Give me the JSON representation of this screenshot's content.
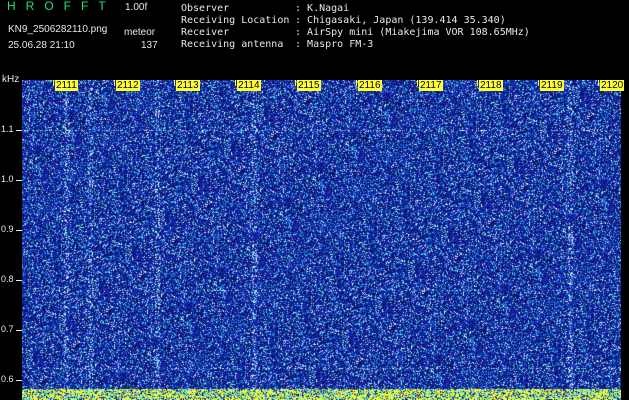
{
  "header": {
    "logo": "HROFFT",
    "version": "1.00f",
    "filename": "KN9_2506282110.png",
    "mode": "meteor",
    "datetime": "25.06.28 21:10",
    "count": "137"
  },
  "info": [
    {
      "label": "Observer",
      "value": "K.Nagai"
    },
    {
      "label": "Receiving Location",
      "value": "Chigasaki, Japan (139.414 35.340)"
    },
    {
      "label": "Receiver",
      "value": "AirSpy mini (Miakejima VOR 108.65MHz)"
    },
    {
      "label": "Receiving antenna",
      "value": "Maspro FM-3"
    }
  ],
  "axes": {
    "y_unit": "kHz",
    "y_ticks": [
      "1.1",
      "1.0",
      "0.9",
      "0.8",
      "0.7",
      "0.6"
    ],
    "x_ticks": [
      "2111",
      "2112",
      "2113",
      "2114",
      "2115",
      "2116",
      "2117",
      "2118",
      "2119",
      "2120"
    ]
  },
  "colors": {
    "background": "#000000",
    "spectrogram_base": "#1a2aa8",
    "text": "#e8e8e8",
    "logo": "#22e07a",
    "time_marker": "#ffff33"
  }
}
